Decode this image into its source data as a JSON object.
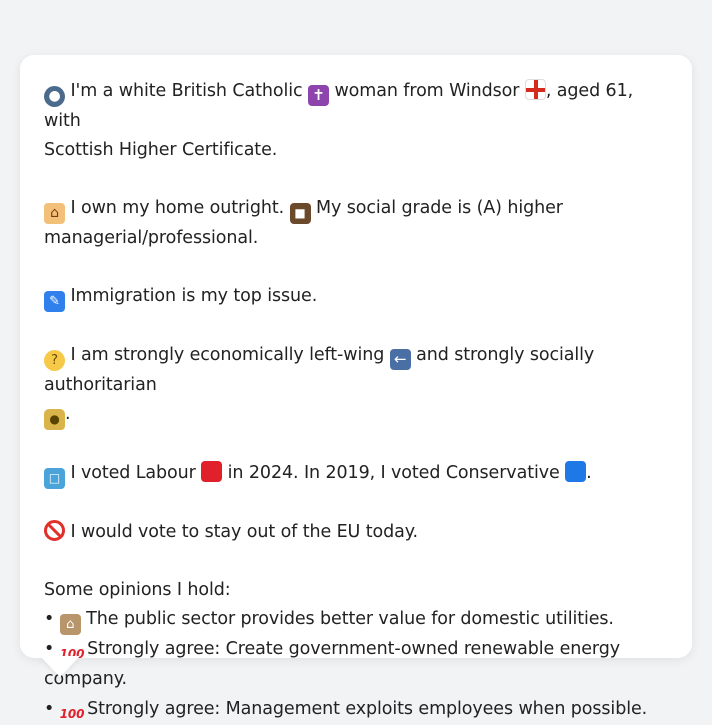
{
  "profile": {
    "line1_a": "I'm a white British Catholic",
    "line1_b": "woman from Windsor",
    "line1_c": ", aged 61, with",
    "line1_d": "Scottish Higher Certificate.",
    "line2_a": "I own my home outright.",
    "line2_b": "My social grade is (A) higher",
    "line2_c": "managerial/professional.",
    "line3": "Immigration is my top issue.",
    "line4_a": "I am strongly economically left-wing",
    "line4_b": "and strongly socially authoritarian",
    "line4_c": ".",
    "line5_a": "I voted Labour",
    "line5_b": "in 2024. In 2019, I voted Conservative",
    "line5_c": ".",
    "line6": "I would vote to stay out of the EU today.",
    "opinions_heading": "Some opinions I hold:",
    "opinions": [
      "The public sector provides better value for domestic utilities.",
      "Strongly agree: Create government-owned renewable energy company.",
      "Strongly agree: Management exploits employees when possible."
    ]
  },
  "icons": {
    "person": "person-silhouette-icon",
    "cross": "latin-cross-icon",
    "flag": "england-flag-icon",
    "house": "house-icon",
    "briefcase": "briefcase-icon",
    "passport": "passport-control-icon",
    "thinking": "thinking-face-icon",
    "left_arrow": "left-arrow-icon",
    "lock": "lock-icon",
    "ballot": "ballot-box-icon",
    "red_square": "red-square-icon",
    "blue_square": "blue-square-icon",
    "prohibited": "prohibited-icon",
    "classical_building": "classical-building-icon",
    "hundred": "hundred-points-icon"
  },
  "colors": {
    "background": "#f1f3f5",
    "card": "#ffffff",
    "labour_red": "#e0202a",
    "conservative_blue": "#1e78e6"
  }
}
